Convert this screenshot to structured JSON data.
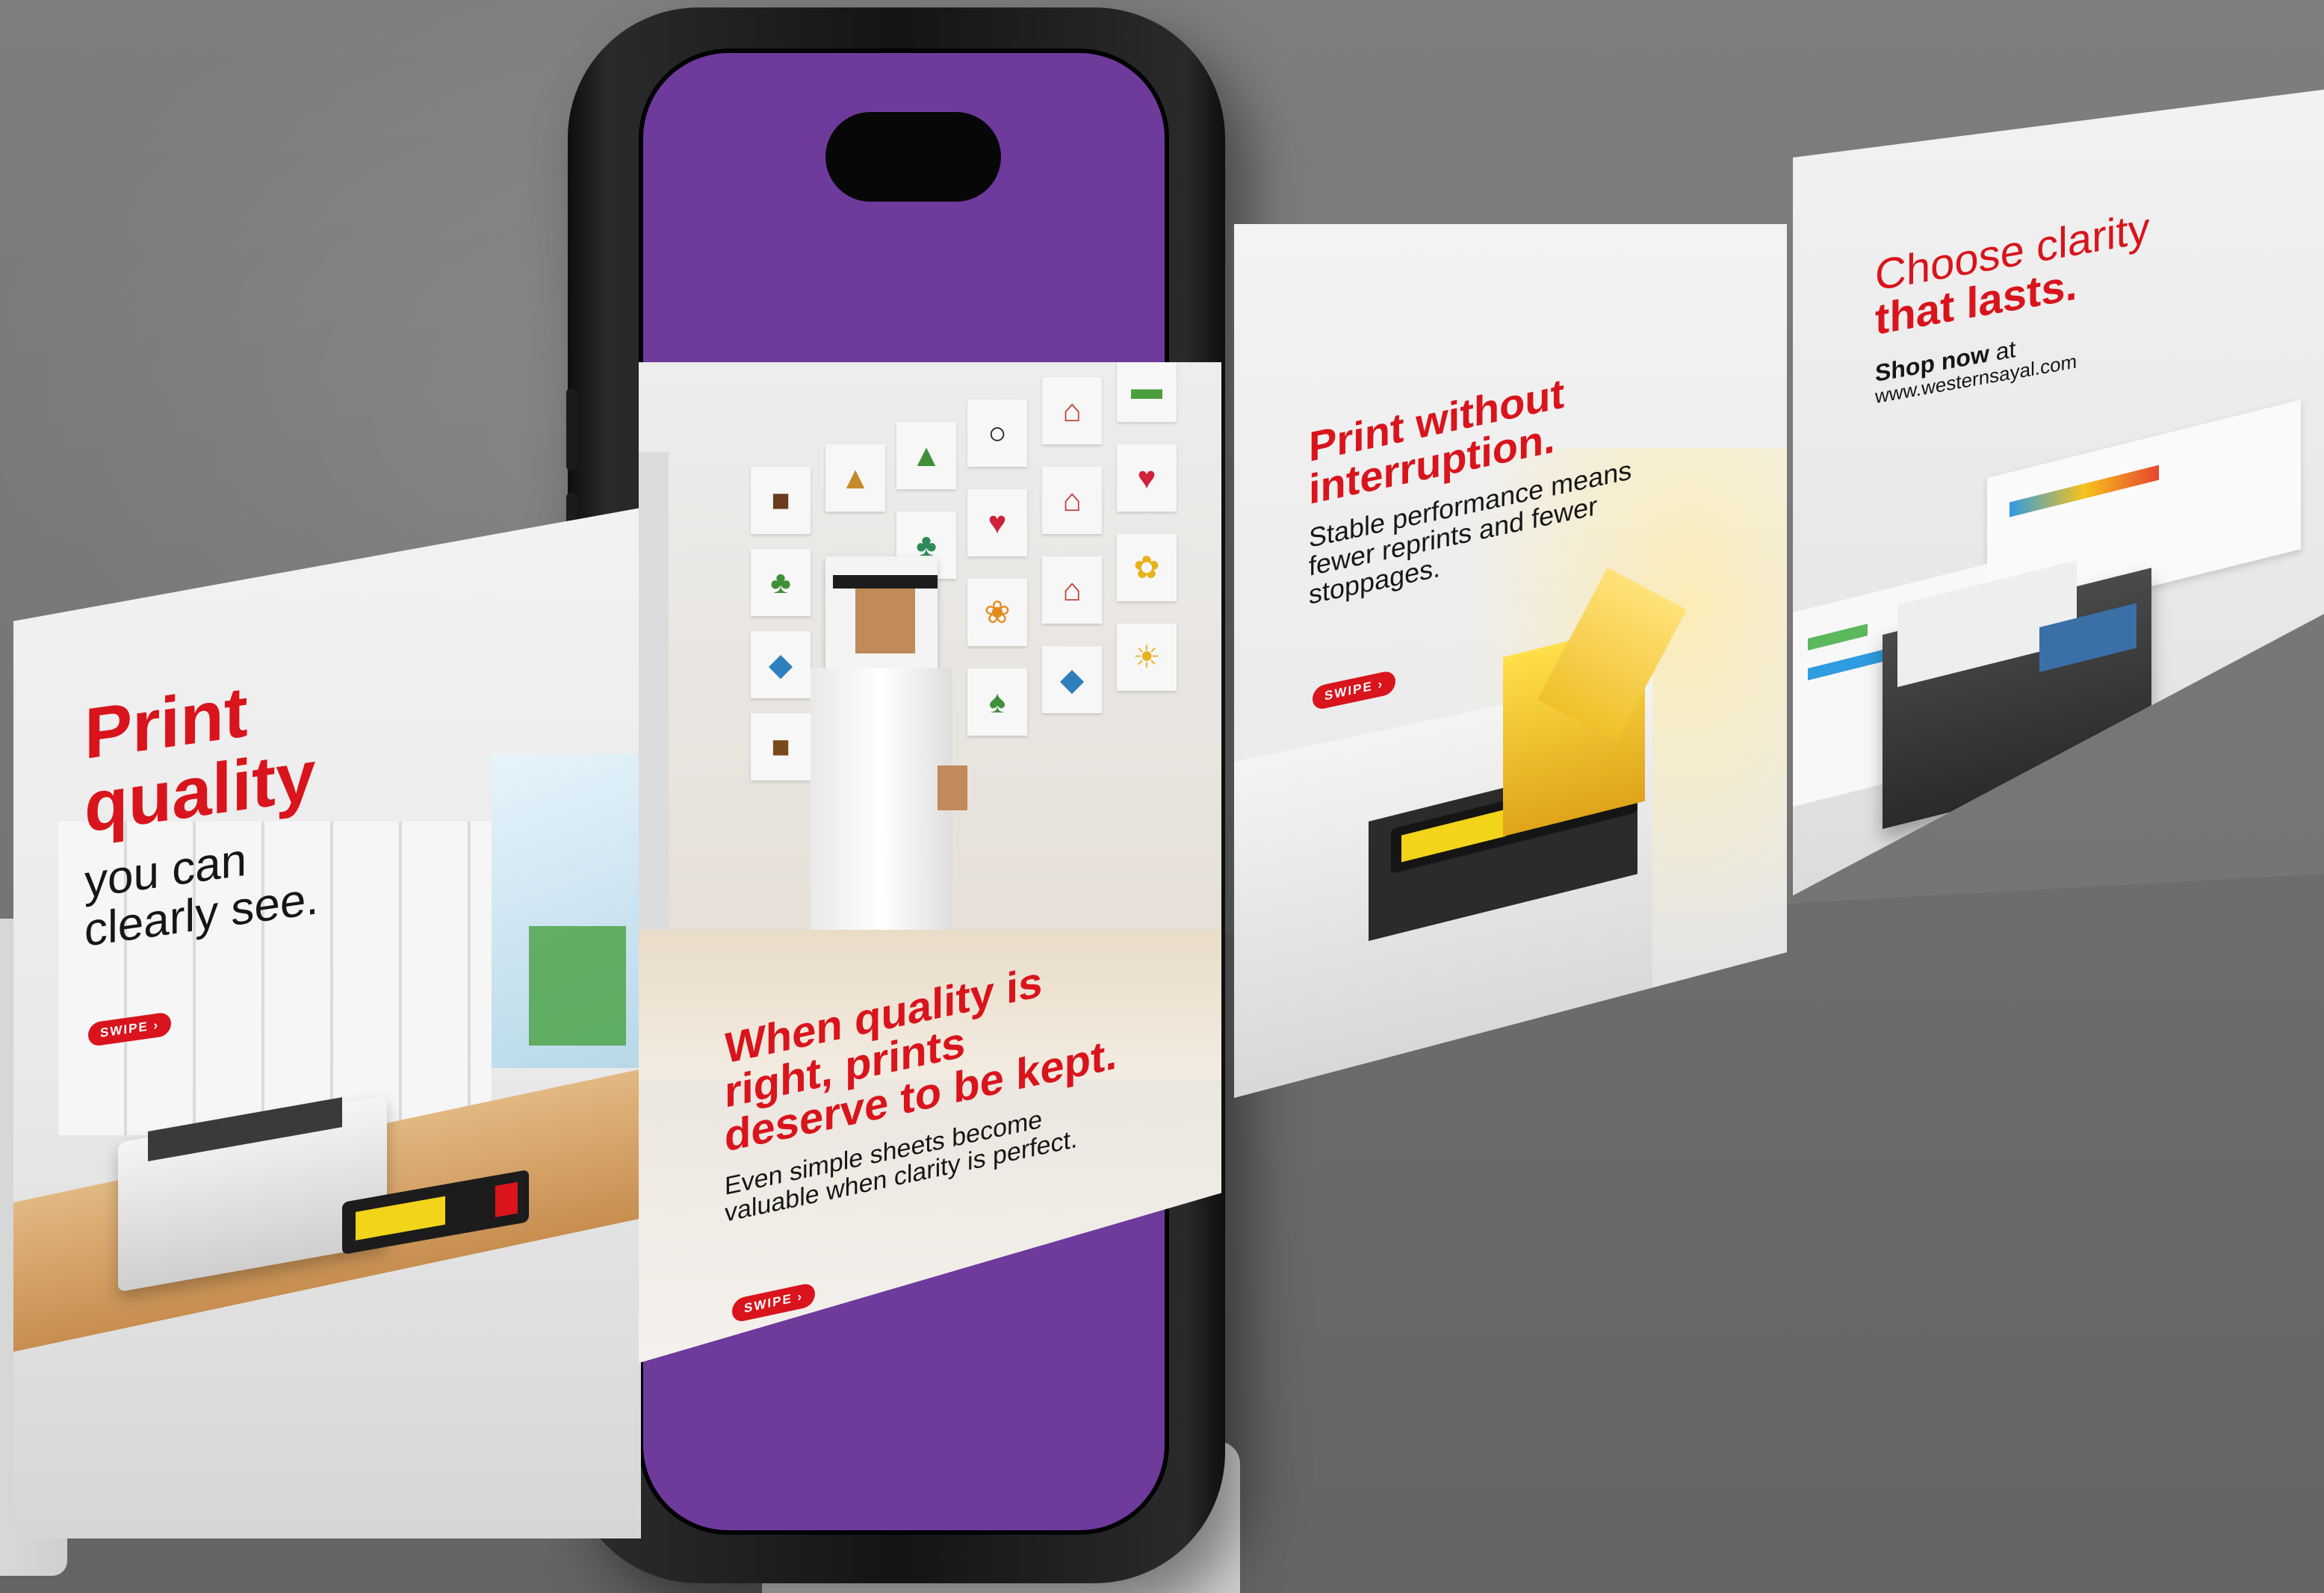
{
  "posters": [
    {
      "headline_line1": "Print",
      "headline_line2": "quality",
      "sub_line1": "you can",
      "sub_line2": "clearly see.",
      "swipe": "SWIPE ›"
    },
    {
      "headline_line1": "When quality is",
      "headline_line2": "right, prints",
      "headline_line3": "deserve to be kept.",
      "body_line1": "Even simple sheets become",
      "body_line2": "valuable when clarity is perfect.",
      "swipe": "SWIPE ›"
    },
    {
      "headline_line1": "Print without",
      "headline_line2": "interruption.",
      "body_line1": "Stable performance means",
      "body_line2": "fewer reprints and fewer",
      "body_line3": "stoppages.",
      "swipe": "SWIPE ›"
    },
    {
      "headline_line1": "Choose clarity",
      "headline_line2": "that lasts.",
      "shop_bold": "Shop now",
      "shop_rest": " at",
      "url": "www.westernsayal.com"
    }
  ],
  "colors": {
    "accent_red": "#d9141c",
    "screen_purple": "#6e3a9c",
    "wall_gray": "#767676"
  },
  "icons": [
    "swipe-chevron-icon"
  ]
}
